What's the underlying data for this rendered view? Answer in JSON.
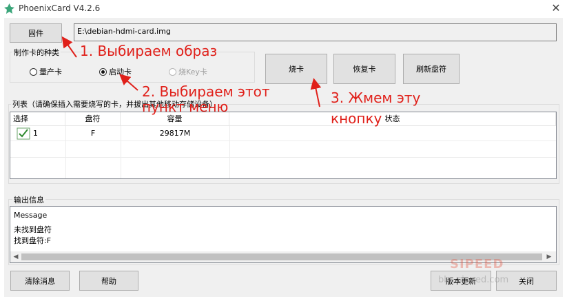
{
  "window": {
    "title": "PhoenixCard V4.2.6",
    "close_glyph": "✕"
  },
  "firmware": {
    "button_label": "固件",
    "path_value": "E:\\debian-hdmi-card.img"
  },
  "card_type": {
    "group_label": "制作卡的种类",
    "options": [
      {
        "label": "量产卡",
        "selected": false,
        "enabled": true
      },
      {
        "label": "启动卡",
        "selected": true,
        "enabled": true
      },
      {
        "label": "烧Key卡",
        "selected": false,
        "enabled": false
      }
    ]
  },
  "actions": {
    "burn": "烧卡",
    "restore": "恢复卡",
    "refresh": "刷新盘符"
  },
  "list": {
    "group_label": "列表（请确保插入需要烧写的卡，并拔出其他移动存储设备）",
    "columns": [
      "选择",
      "盘符",
      "容量",
      "状态"
    ],
    "rows": [
      {
        "index": "1",
        "drive": "F",
        "capacity": "29817M",
        "status": "",
        "checked": true
      }
    ]
  },
  "output": {
    "group_label": "输出信息",
    "header": "Message",
    "lines": [
      "未找到盘符",
      "找到盘符:F"
    ]
  },
  "bottom": {
    "clear": "清除消息",
    "help": "帮助",
    "update_prefix": "版本更新",
    "exit": "关闭"
  },
  "annotations": {
    "step1": "1. Выбираем образ",
    "step2_line1": "2. Выбираем этот",
    "step2_line2": "пункт меню",
    "step3_line1": "3. Жмем эту",
    "step3_line2": "кнопку",
    "color": "#e0201a"
  },
  "watermark": {
    "logo": "SIPEED",
    "site": "bbs.sipeed.com"
  }
}
